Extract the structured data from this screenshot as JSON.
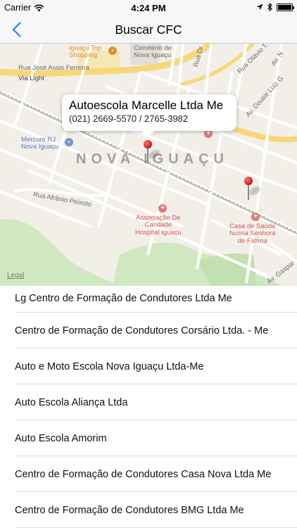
{
  "status_bar": {
    "carrier": "Carrier",
    "time": "4:24 PM",
    "battery_level": 1.0
  },
  "nav": {
    "title": "Buscar CFC",
    "back_icon": "chevron-left-icon",
    "accent_color": "#2f7cf6"
  },
  "map": {
    "labels": {
      "shopping_line1": "Iguaçu Top",
      "shopping_line2": "Shopping",
      "cemetery_line1": "Cemitério de",
      "cemetery_line2": "Nova Iguaçu",
      "rua_jose": "Rua José Assis Ferreira",
      "via_light": "Via Light",
      "rua_dr": "Rua Dr",
      "rua_otavio": "Rua Otávio T.",
      "av_n": "Av. N",
      "av_doutor": "Av. Doutor Luiz G",
      "mercure_line1": "Mercure RJ",
      "mercure_line2": "Nova Iguaçu",
      "district": "NOVA IGUAÇU",
      "rua_afranio": "Rua Afrânio Peixoto",
      "assoc_line1": "Associação De",
      "assoc_line2": "Caridade",
      "assoc_line3": "Hospital Iguaçu",
      "casa_line1": "Casa de Saúde",
      "casa_line2": "Nossa Senhora",
      "casa_line3": "de Fátima",
      "av_gaspar": "Av. Gaspar",
      "legal": "Legal"
    },
    "callout": {
      "title": "Autoescola Marcelle Ltda Me",
      "phones": "(021) 2669-5570 / 2765-3982"
    },
    "pin_color": "#d81e1e"
  },
  "list": {
    "items": [
      "Lg Centro de Formação de Condutores Ltda Me",
      "Centro de Formação de Condutores Corsário Ltda. - Me",
      "Auto e Moto Escola Nova Iguaçu Ltda-Me",
      "Auto Escola Aliança Ltda",
      "Auto Escola Amorim",
      "Centro de Formação de Condutores Casa Nova Ltda Me",
      "Centro de Formação de Condutores BMG Ltda Me"
    ]
  }
}
